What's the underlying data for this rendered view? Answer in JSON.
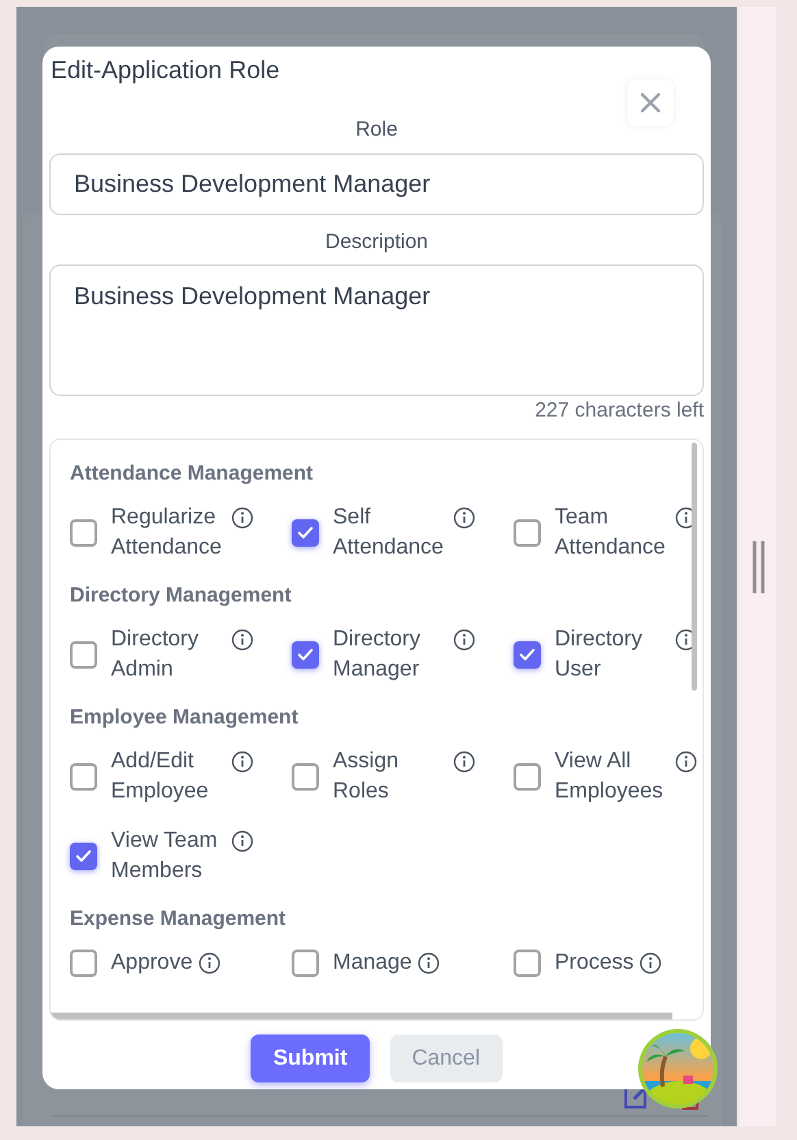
{
  "dialog": {
    "title": "Edit-Application Role",
    "role": {
      "label": "Role",
      "value": "Business Development Manager"
    },
    "description": {
      "label": "Description",
      "value": "Business Development Manager"
    },
    "char_count": "227 characters left",
    "groups": [
      {
        "title": "Attendance Management",
        "permissions": [
          {
            "label": "Regularize Attendance",
            "checked": false
          },
          {
            "label": "Self Attendance",
            "checked": true
          },
          {
            "label": "Team Attendance",
            "checked": false
          }
        ]
      },
      {
        "title": "Directory Management",
        "permissions": [
          {
            "label": "Directory Admin",
            "checked": false
          },
          {
            "label": "Directory Manager",
            "checked": true
          },
          {
            "label": "Directory User",
            "checked": true
          }
        ]
      },
      {
        "title": "Employee Management",
        "permissions": [
          {
            "label": "Add/Edit Employee",
            "checked": false
          },
          {
            "label": "Assign Roles",
            "checked": false
          },
          {
            "label": "View All Employees",
            "checked": false
          },
          {
            "label": "View Team Members",
            "checked": true
          }
        ]
      },
      {
        "title": "Expense Management",
        "permissions": [
          {
            "label": "Approve",
            "checked": false
          },
          {
            "label": "Manage",
            "checked": false
          },
          {
            "label": "Process",
            "checked": false
          }
        ]
      }
    ],
    "buttons": [
      {
        "label": "Submit",
        "kind": "primary"
      },
      {
        "label": "Cancel",
        "kind": "secondary"
      }
    ]
  }
}
